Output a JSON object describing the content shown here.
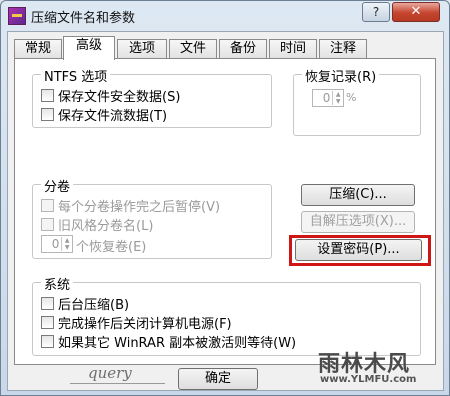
{
  "window": {
    "title": "压缩文件名和参数",
    "help_label": "?",
    "close_label": "✕"
  },
  "tabs": [
    {
      "label": "常规"
    },
    {
      "label": "高级"
    },
    {
      "label": "选项"
    },
    {
      "label": "文件"
    },
    {
      "label": "备份"
    },
    {
      "label": "时间"
    },
    {
      "label": "注释"
    }
  ],
  "ntfs": {
    "title": "NTFS 选项",
    "items": [
      {
        "label": "保存文件安全数据(S)"
      },
      {
        "label": "保存文件流数据(T)"
      }
    ]
  },
  "recovery": {
    "title": "恢复记录(R)",
    "value": "0",
    "unit": "%"
  },
  "volumes": {
    "title": "分卷",
    "items": [
      {
        "label": "每个分卷操作完之后暂停(V)"
      },
      {
        "label": "旧风格分卷名(L)"
      }
    ],
    "spin_value": "0",
    "spin_label": "个恢复卷(E)"
  },
  "buttons": {
    "compress": "压缩(C)...",
    "sfx": "自解压选项(X)...",
    "password": "设置密码(P)..."
  },
  "system": {
    "title": "系统",
    "items": [
      {
        "label": "后台压缩(B)"
      },
      {
        "label": "完成操作后关闭计算机电源(F)"
      },
      {
        "label": "如果其它 WinRAR 副本被激活则等待(W)"
      }
    ]
  },
  "footer": {
    "ok_label": "确定"
  },
  "overlay": {
    "signature": "query",
    "watermark": "雨林木风",
    "watermark_url": "www.YLMFU.com"
  }
}
